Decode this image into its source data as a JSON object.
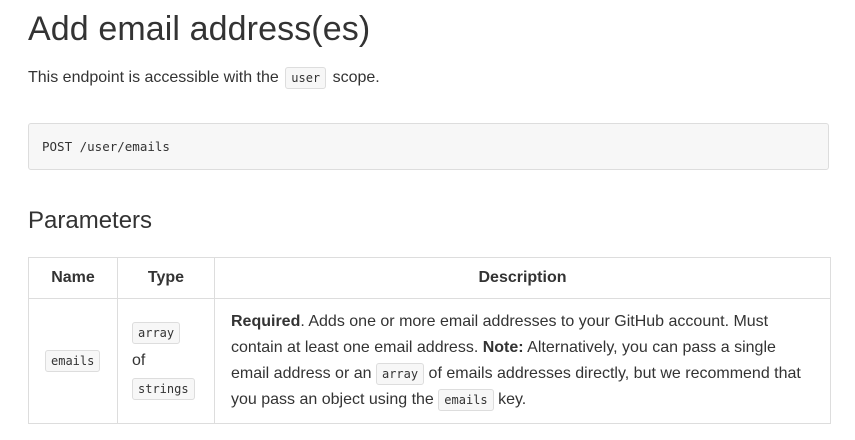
{
  "page_title": "Add email address(es)",
  "intro": {
    "text_before": "This endpoint is accessible with the",
    "scope_code": "user",
    "text_after": "scope."
  },
  "endpoint": "POST /user/emails",
  "parameters_heading": "Parameters",
  "table": {
    "headers": {
      "name": "Name",
      "type": "Type",
      "description": "Description"
    },
    "rows": [
      {
        "name": "emails",
        "type_code_1": "array",
        "type_of": "of",
        "type_code_2": "strings",
        "desc_required": "Required",
        "desc_text_1": ". Adds one or more email addresses to your GitHub account. Must contain at least one email address.",
        "desc_note": "Note:",
        "desc_text_2": "Alternatively, you can pass a single email address or an",
        "desc_code_1": "array",
        "desc_text_3": "of emails addresses directly, but we recommend that you pass an object using the",
        "desc_code_2": "emails",
        "desc_text_4": "key."
      }
    ]
  }
}
